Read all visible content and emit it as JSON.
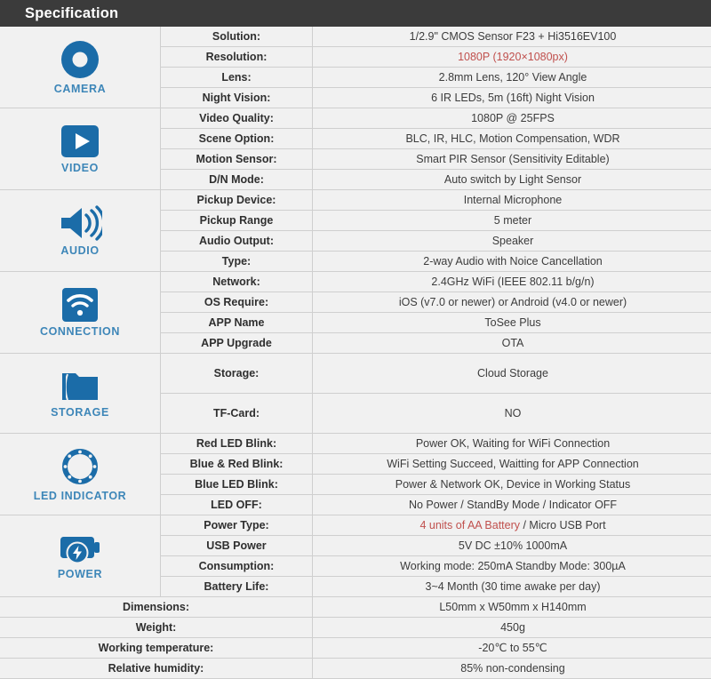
{
  "header": {
    "title": "Specification"
  },
  "sections": [
    {
      "icon": "camera-lens-icon",
      "label": "CAMERA",
      "rows": [
        {
          "label": "Solution:",
          "value": "1/2.9\" CMOS Sensor F23 + Hi3516EV100"
        },
        {
          "label": "Resolution:",
          "value": "1080P (1920×1080px)",
          "highlight": true
        },
        {
          "label": "Lens:",
          "value": "2.8mm Lens,  120° View Angle"
        },
        {
          "label": "Night Vision:",
          "value": "6 IR LEDs, 5m (16ft) Night Vision"
        }
      ]
    },
    {
      "icon": "video-play-icon",
      "label": "VIDEO",
      "rows": [
        {
          "label": "Video Quality:",
          "value": "1080P @ 25FPS"
        },
        {
          "label": "Scene Option:",
          "value": "BLC, IR, HLC, Motion Compensation, WDR"
        },
        {
          "label": "Motion Sensor:",
          "value": "Smart PIR Sensor (Sensitivity Editable)"
        },
        {
          "label": "D/N Mode:",
          "value": "Auto switch by Light Sensor"
        }
      ]
    },
    {
      "icon": "speaker-audio-icon",
      "label": "AUDIO",
      "rows": [
        {
          "label": "Pickup Device:",
          "value": "Internal Microphone"
        },
        {
          "label": "Pickup Range",
          "value": "5 meter"
        },
        {
          "label": "Audio Output:",
          "value": "Speaker"
        },
        {
          "label": "Type:",
          "value": "2-way Audio with Noice Cancellation"
        }
      ]
    },
    {
      "icon": "wifi-icon",
      "label": "CONNECTION",
      "rows": [
        {
          "label": "Network:",
          "value": "2.4GHz WiFi (IEEE 802.11 b/g/n)"
        },
        {
          "label": "OS Require:",
          "value": "iOS (v7.0 or newer) or Android (v4.0 or newer)"
        },
        {
          "label": "APP Name",
          "value": "ToSee Plus"
        },
        {
          "label": "APP Upgrade",
          "value": "OTA"
        }
      ]
    },
    {
      "icon": "folder-storage-icon",
      "label": "STORAGE",
      "rows": [
        {
          "label": "Storage:",
          "value": "Cloud Storage",
          "tall": true
        },
        {
          "label": "TF-Card:",
          "value": "NO",
          "tall": true
        }
      ]
    },
    {
      "icon": "led-ring-icon",
      "label": "LED INDICATOR",
      "rows": [
        {
          "label": "Red LED Blink:",
          "value": "Power OK, Waiting for WiFi Connection"
        },
        {
          "label": "Blue & Red Blink:",
          "value": "WiFi Setting Succeed, Waitting for APP Connection"
        },
        {
          "label": "Blue LED Blink:",
          "value": "Power & Network OK, Device in Working Status"
        },
        {
          "label": "LED OFF:",
          "value": "No Power / StandBy Mode / Indicator OFF"
        }
      ]
    },
    {
      "icon": "battery-power-icon",
      "label": "POWER",
      "rows": [
        {
          "label": "Power Type:",
          "value": "4 units of AA Battery / Micro USB Port",
          "value_parts": [
            {
              "text": "4 units of AA Battery",
              "color": "red"
            },
            {
              "text": " / Micro USB Port",
              "color": "dark"
            }
          ]
        },
        {
          "label": "USB Power",
          "value": "5V DC ±10%  1000mA"
        },
        {
          "label": "Consumption:",
          "value": "Working mode: 250mA Standby Mode: 300µA"
        },
        {
          "label": "Battery Life:",
          "value": "3~4 Month (30 time awake per day)"
        }
      ]
    }
  ],
  "footer_rows": [
    {
      "label": "Dimensions:",
      "value": "L50mm x W50mm x H140mm"
    },
    {
      "label": "Weight:",
      "value": "450g"
    },
    {
      "label": "Working temperature:",
      "value": "-20℃ to 55℃"
    },
    {
      "label": "Relative humidity:",
      "value": "85% non-condensing"
    }
  ],
  "colors": {
    "header_bg": "#3b3b3b",
    "icon_blue": "#1b6ca8",
    "label_blue": "#3d86b8",
    "highlight_red": "#c0504d",
    "cell_bg": "#f1f1f1"
  }
}
